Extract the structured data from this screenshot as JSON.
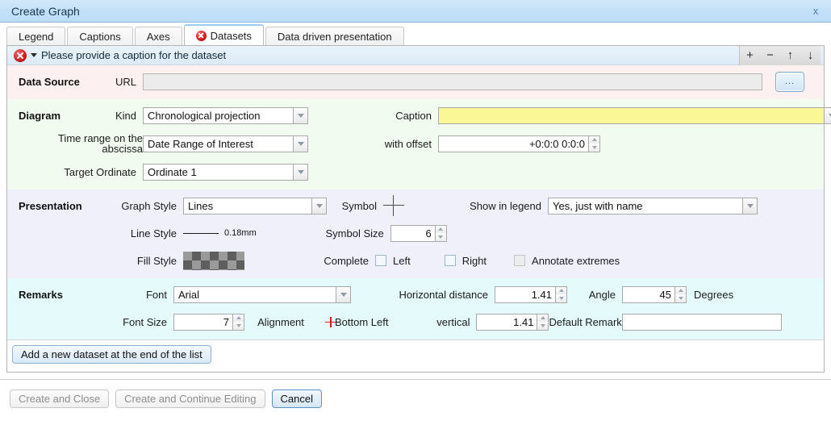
{
  "window": {
    "title": "Create Graph",
    "close_label": "x"
  },
  "tabs": [
    {
      "label": "Legend",
      "active": false,
      "error": false
    },
    {
      "label": "Captions",
      "active": false,
      "error": false
    },
    {
      "label": "Axes",
      "active": false,
      "error": false
    },
    {
      "label": "Datasets",
      "active": true,
      "error": true
    },
    {
      "label": "Data driven presentation",
      "active": false,
      "error": false
    }
  ],
  "dataset_header": {
    "message": "Please provide a caption for the dataset",
    "tools": {
      "add": "+",
      "remove": "−",
      "move_up": "↑",
      "move_down": "↓"
    }
  },
  "data_source": {
    "section_title": "Data Source",
    "url_label": "URL",
    "url_value": "",
    "url_placeholder": "",
    "browse_label": "..."
  },
  "diagram": {
    "section_title": "Diagram",
    "kind_label": "Kind",
    "kind_value": "Chronological projection",
    "time_range_label_line1": "Time range on the",
    "time_range_label_line2": "abscissa",
    "time_range_value": "Date Range of Interest",
    "target_ordinate_label": "Target Ordinate",
    "target_ordinate_value": "Ordinate 1",
    "caption_label": "Caption",
    "caption_value": "",
    "offset_label": "with offset",
    "offset_value": "+0:0:0 0:0:0"
  },
  "presentation": {
    "section_title": "Presentation",
    "graph_style_label": "Graph Style",
    "graph_style_value": "Lines",
    "line_style_label": "Line Style",
    "line_style_value": "0.18mm",
    "fill_style_label": "Fill Style",
    "symbol_label": "Symbol",
    "symbol_size_label": "Symbol Size",
    "symbol_size_value": "6",
    "complete_label": "Complete",
    "left_label": "Left",
    "right_label": "Right",
    "annotate_extremes_label": "Annotate extremes",
    "show_in_legend_label": "Show in legend",
    "show_in_legend_value": "Yes, just with name"
  },
  "remarks": {
    "section_title": "Remarks",
    "font_label": "Font",
    "font_value": "Arial",
    "font_size_label": "Font Size",
    "font_size_value": "7",
    "alignment_label": "Alignment",
    "alignment_value": "Bottom Left",
    "horizontal_distance_label": "Horizontal distance",
    "horizontal_distance_value": "1.41",
    "vertical_label": "vertical",
    "vertical_value": "1.41",
    "angle_label": "Angle",
    "angle_value": "45",
    "degrees_label": "Degrees",
    "default_remark_label": "Default Remark",
    "default_remark_value": ""
  },
  "actions": {
    "add_dataset": "Add a new dataset at the end of the list",
    "create_and_close": "Create and Close",
    "create_and_continue": "Create and Continue Editing",
    "cancel": "Cancel"
  }
}
